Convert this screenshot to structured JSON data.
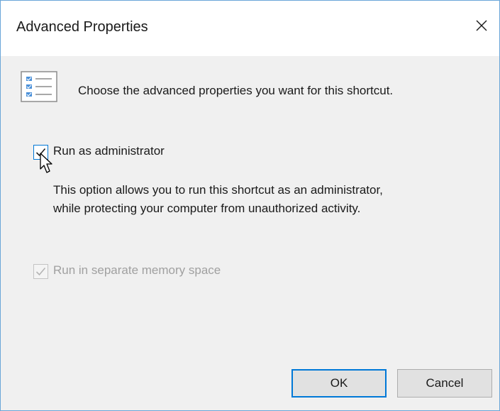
{
  "dialog": {
    "title": "Advanced Properties",
    "close_icon": "close-icon",
    "header_icon": "list-checklist-icon",
    "header_text": "Choose the advanced properties you want for this shortcut."
  },
  "options": {
    "run_as_admin": {
      "label": "Run as administrator",
      "checked": true,
      "enabled": true
    },
    "description": "This option allows you to run this shortcut as an administrator, while protecting your computer from unauthorized activity.",
    "separate_memory": {
      "label": "Run in separate memory space",
      "checked": true,
      "enabled": false
    }
  },
  "buttons": {
    "ok": "OK",
    "cancel": "Cancel"
  },
  "colors": {
    "accent": "#0078d7",
    "window_border": "#6aa6d8",
    "dialog_bg": "#f0f0f0",
    "disabled_text": "#a0a0a0"
  }
}
